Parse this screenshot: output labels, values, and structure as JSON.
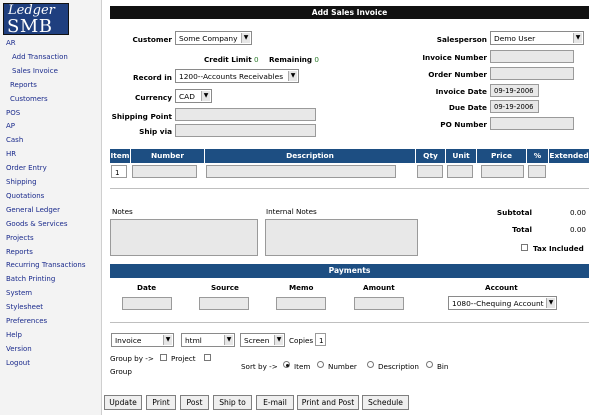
{
  "logo": {
    "line1": "Ledger",
    "line2": "SMB"
  },
  "menu": [
    {
      "label": "AR",
      "level": 0
    },
    {
      "label": "Add Transaction",
      "level": 2
    },
    {
      "label": "Sales Invoice",
      "level": 2
    },
    {
      "label": "Reports",
      "level": 1
    },
    {
      "label": "Customers",
      "level": 1
    },
    {
      "label": "POS",
      "level": 0
    },
    {
      "label": "AP",
      "level": 0
    },
    {
      "label": "Cash",
      "level": 0
    },
    {
      "label": "HR",
      "level": 0
    },
    {
      "label": "Order Entry",
      "level": 0
    },
    {
      "label": "Shipping",
      "level": 0
    },
    {
      "label": "Quotations",
      "level": 0
    },
    {
      "label": "General Ledger",
      "level": 0
    },
    {
      "label": "Goods & Services",
      "level": 0
    },
    {
      "label": "Projects",
      "level": 0
    },
    {
      "label": "Reports",
      "level": 0
    },
    {
      "label": "Recurring Transactions",
      "level": 0
    },
    {
      "label": "Batch Printing",
      "level": 0
    },
    {
      "label": "System",
      "level": 0
    },
    {
      "label": "Stylesheet",
      "level": 0
    },
    {
      "label": "Preferences",
      "level": 0
    },
    {
      "label": "Help",
      "level": 0
    },
    {
      "label": "Version",
      "level": 0
    },
    {
      "label": "Logout",
      "level": 0
    }
  ],
  "title": "Add Sales Invoice",
  "form": {
    "customer_label": "Customer",
    "customer_value": "Some Company",
    "credit_limit_label": "Credit Limit",
    "credit_limit_value": "0",
    "remaining_label": "Remaining",
    "remaining_value": "0",
    "record_in_label": "Record in",
    "record_in_value": "1200--Accounts Receivables",
    "currency_label": "Currency",
    "currency_value": "CAD",
    "shipping_point_label": "Shipping Point",
    "ship_via_label": "Ship via",
    "salesperson_label": "Salesperson",
    "salesperson_value": "Demo User",
    "invoice_number_label": "Invoice Number",
    "order_number_label": "Order Number",
    "invoice_date_label": "Invoice Date",
    "invoice_date_value": "09-19-2006",
    "due_date_label": "Due Date",
    "due_date_value": "09-19-2006",
    "po_number_label": "PO Number"
  },
  "lines": {
    "headers": [
      "Item",
      "Number",
      "Description",
      "Qty",
      "Unit",
      "Price",
      "%",
      "Extended"
    ],
    "row1_item": "1"
  },
  "notes": {
    "notes_label": "Notes",
    "internal_notes_label": "Internal Notes",
    "subtotal_label": "Subtotal",
    "subtotal_value": "0.00",
    "total_label": "Total",
    "total_value": "0.00",
    "tax_included_label": "Tax Included"
  },
  "payments": {
    "title": "Payments",
    "date_label": "Date",
    "source_label": "Source",
    "memo_label": "Memo",
    "amount_label": "Amount",
    "account_label": "Account",
    "account_value": "1080--Chequing Account"
  },
  "print": {
    "format_value": "Invoice",
    "type_value": "html",
    "media_value": "Screen",
    "copies_label": "Copies",
    "copies_value": "1",
    "group_by_label": "Group by ->",
    "project_label": "Project",
    "group_label": "Group",
    "sort_by_label": "Sort by ->",
    "sort_options": [
      "Item",
      "Number",
      "Description",
      "Bin"
    ]
  },
  "buttons": [
    "Update",
    "Print",
    "Post",
    "Ship to",
    "E-mail",
    "Print and Post",
    "Schedule"
  ]
}
